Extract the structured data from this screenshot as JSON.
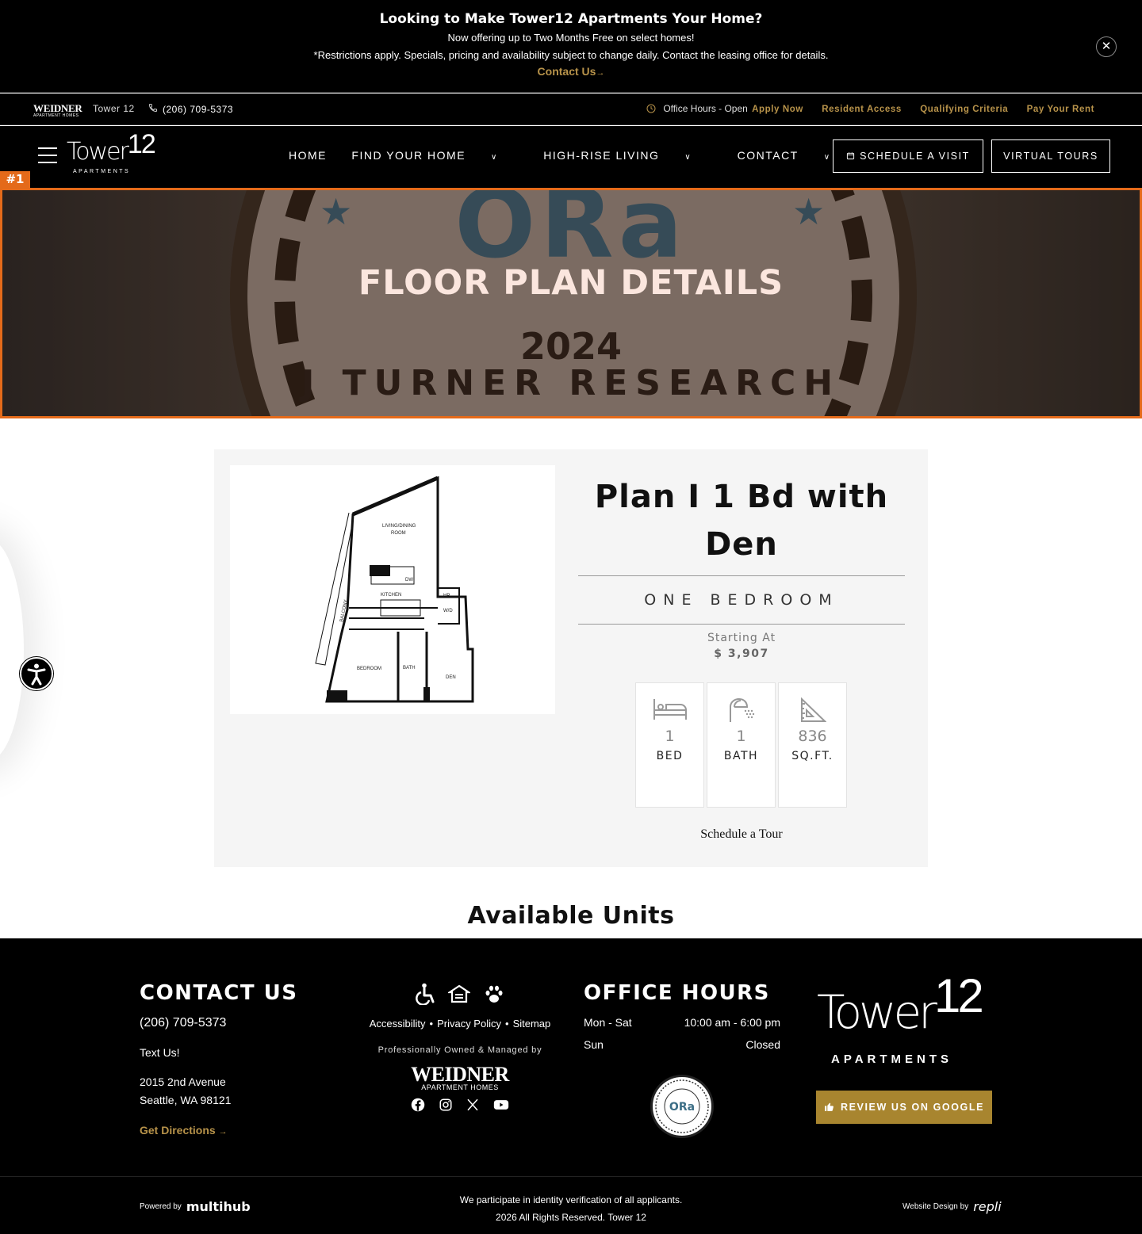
{
  "promo": {
    "headline": "Looking to Make Tower12 Apartments Your Home?",
    "sub": "Now offering up to Two Months Free on select homes!",
    "fine": "*Restrictions apply. Specials, pricing and availability subject to change daily. Contact the leasing office for details.",
    "cta": "Contact Us",
    "cta_arrow": "→",
    "close": "✕"
  },
  "util": {
    "brand_logo": "WEIDNER",
    "brand_logo_sub": "APARTMENT HOMES",
    "property": "Tower 12",
    "phone": "(206) 709-5373",
    "hours": "Office Hours - Open",
    "links": [
      "Apply Now",
      "Resident Access",
      "Qualifying Criteria",
      "Pay Your Rent"
    ]
  },
  "nav": {
    "logo_text": "Tower",
    "logo_num": "12",
    "logo_sub": "APARTMENTS",
    "menu": [
      "HOME",
      "FIND YOUR HOME",
      "HIGH-RISE LIVING",
      "CONTACT"
    ],
    "schedule": "SCHEDULE A VISIT",
    "tours": "VIRTUAL TOURS"
  },
  "hero": {
    "badge": "#1",
    "title": "FLOOR PLAN DETAILS",
    "seal_brand": "ORa",
    "seal_year": "2024",
    "seal_arc": "J TURNER RESEARCH"
  },
  "plan": {
    "name": "Plan I 1 Bd with Den",
    "type": "ONE BEDROOM",
    "starting_label": "Starting At",
    "price": "$ 3,907",
    "stats": [
      {
        "value": "1",
        "label": "BED",
        "icon": "bed-icon"
      },
      {
        "value": "1",
        "label": "BATH",
        "icon": "shower-icon"
      },
      {
        "value": "836",
        "label": "SQ.FT.",
        "icon": "ruler-triangle-icon"
      }
    ],
    "tour": "Schedule a Tour",
    "drawing_labels": {
      "living": "LIVING/DINING",
      "room": "ROOM",
      "kitchen": "KITCHEN",
      "balcony": "BALCONY",
      "bedroom": "BEDROOM",
      "bath": "BATH",
      "den": "DEN",
      "hp": "HP",
      "wd": "W/D",
      "dw": "DW"
    }
  },
  "available": "Available Units",
  "footer": {
    "contact_title": "CONTACT US",
    "phone": "(206) 709-5373",
    "text": "Text Us!",
    "address1": "2015 2nd Avenue",
    "address2": "Seattle, WA 98121",
    "directions": "Get Directions",
    "directions_arrow": "→",
    "links": [
      "Accessibility",
      "Privacy Policy",
      "Sitemap"
    ],
    "separator": "•",
    "owned": "Professionally Owned & Managed by",
    "owner_logo": "WEIDNER",
    "owner_logo_sub": "APARTMENT HOMES",
    "hours_title": "OFFICE HOURS",
    "hours": [
      {
        "day": "Mon - Sat",
        "time": "10:00 am - 6:00 pm"
      },
      {
        "day": "Sun",
        "time": "Closed"
      }
    ],
    "seal_text": "ORa",
    "logo_text": "Tower",
    "logo_num": "12",
    "logo_sub": "APARTMENTS",
    "review": "REVIEW US ON GOOGLE",
    "powered": "Powered by",
    "powered_brand": "multihub",
    "identity": "We participate in identity verification of all applicants.",
    "copyright": "2026 All Rights Reserved. Tower 12",
    "design": "Website Design by",
    "design_brand": "repli"
  }
}
